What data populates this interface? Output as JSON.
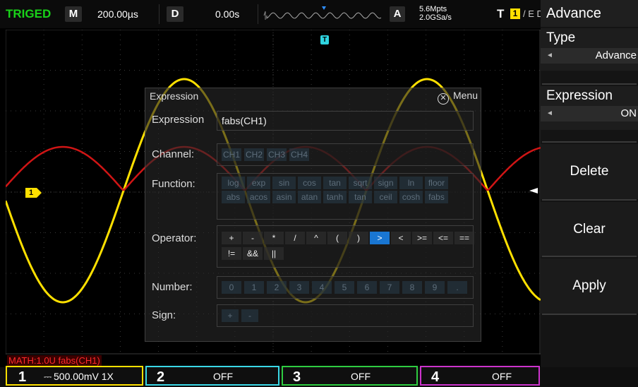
{
  "topbar": {
    "status": "TRIGED",
    "mode_label": "M",
    "timebase": "200.00µs",
    "delay_label": "D",
    "delay_value": "0.00s",
    "acq_label": "A",
    "memory_depth": "5.6Mpts",
    "sample_rate": "2.0GSa/s",
    "trig_label": "T",
    "trig_source": "1",
    "trig_slope_text": "/ E D"
  },
  "markers": {
    "trigger_top": "T",
    "ch1_offset": "1"
  },
  "math_label": "MATH:1.0U fabs(CH1)",
  "channels": [
    {
      "num": "1",
      "text": "500.00mV 1X",
      "color": "#ffe000"
    },
    {
      "num": "2",
      "text": "OFF",
      "color": "#3ad7e6"
    },
    {
      "num": "3",
      "text": "OFF",
      "color": "#2ecc40"
    },
    {
      "num": "4",
      "text": "OFF",
      "color": "#cc33cc"
    }
  ],
  "right_panel": {
    "title": "Advance",
    "type_label": "Type",
    "type_value": "Advance",
    "expression_label": "Expression",
    "expression_value": "ON",
    "delete": "Delete",
    "clear": "Clear",
    "apply": "Apply"
  },
  "dialog": {
    "title": "Expression",
    "menu": "Menu",
    "expression_label": "Expression",
    "expression_value": "fabs(CH1)",
    "channel_label": "Channel:",
    "channels": [
      "CH1",
      "CH2",
      "CH3",
      "CH4"
    ],
    "function_label": "Function:",
    "functions": [
      "log",
      "exp",
      "sin",
      "cos",
      "tan",
      "sqrt",
      "sign",
      "ln",
      "floor",
      "abs",
      "acos",
      "asin",
      "atan",
      "tanh",
      "tan",
      "ceil",
      "cosh",
      "fabs"
    ],
    "operator_label": "Operator:",
    "operators": [
      "+",
      "-",
      "*",
      "/",
      "^",
      "(",
      ")",
      ">",
      "<",
      ">=",
      "<=",
      "==",
      "!=",
      "&&",
      "||"
    ],
    "number_label": "Number:",
    "numbers": [
      "0",
      "1",
      "2",
      "3",
      "4",
      "5",
      "6",
      "7",
      "8",
      "9",
      "."
    ],
    "sign_label": "Sign:",
    "signs": [
      "+",
      "-"
    ]
  },
  "colors": {
    "ch1": "#ffe000",
    "math": "#e01010",
    "triged": "#19d219",
    "selected_key": "#1976d2"
  }
}
